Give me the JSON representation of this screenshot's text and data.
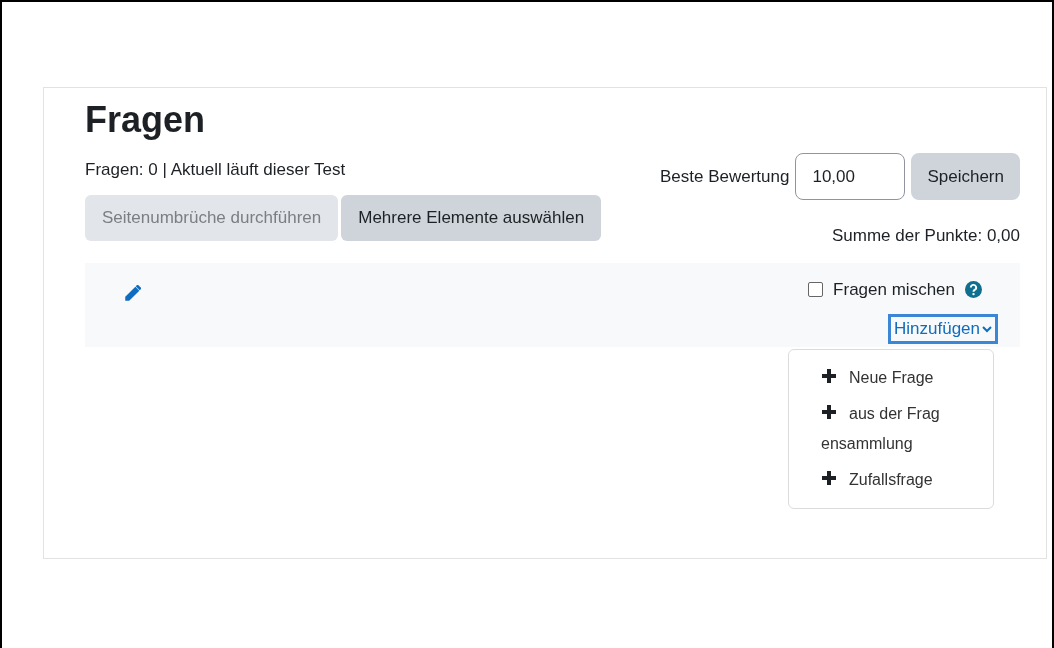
{
  "heading": "Fragen",
  "info": "Fragen: 0 | Aktuell läuft dieser Test",
  "grade": {
    "label": "Beste Bewertung",
    "value": "10,00",
    "button": "Speichern"
  },
  "buttons": [
    {
      "label": "Seitenumbrüche durchführen",
      "disabled": true
    },
    {
      "label": "Mehrere Elemente auswählen",
      "disabled": false
    }
  ],
  "total": "Summe der Punkte: 0,00",
  "shuffle": {
    "label": "Fragen mischen",
    "checked": false
  },
  "add_menu": {
    "label": "Hinzufügen",
    "expanded": true,
    "items": [
      {
        "label": "Neue Frage"
      },
      {
        "label": "aus der Fragensammlung"
      },
      {
        "label": "Zufallsfrage"
      }
    ]
  }
}
